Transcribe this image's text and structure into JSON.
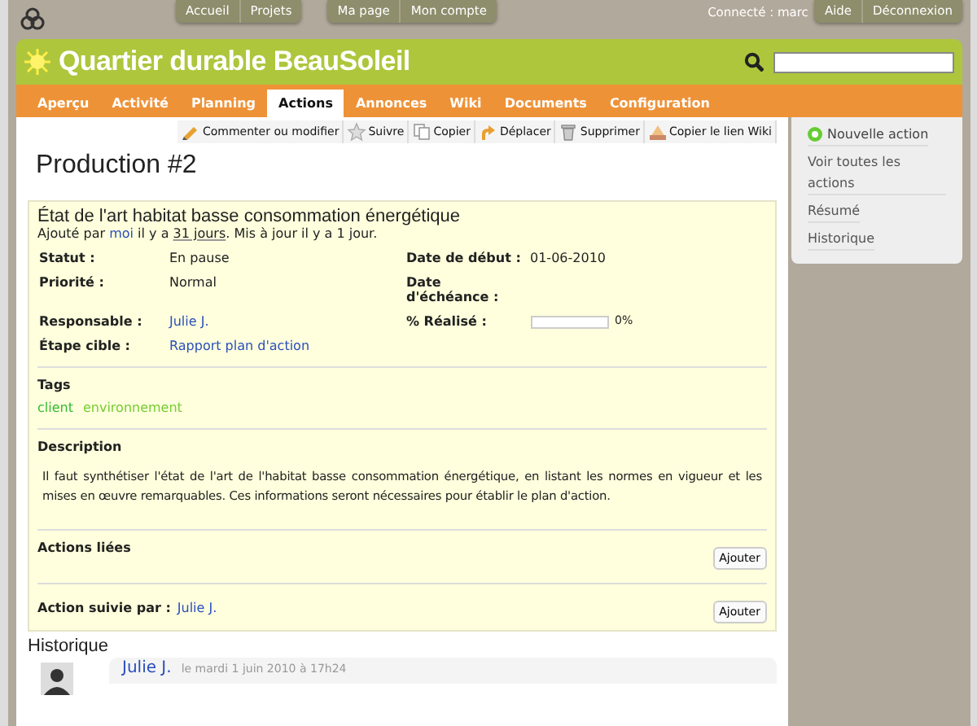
{
  "top_menu": {
    "groups": [
      [
        "Accueil",
        "Projets"
      ],
      [
        "Ma page",
        "Mon compte"
      ]
    ],
    "logged_in": "Connecté : marc",
    "account": [
      "Aide",
      "Déconnexion"
    ]
  },
  "project": {
    "title": "Quartier durable BeauSoleil"
  },
  "tabs": [
    {
      "label": "Aperçu",
      "selected": false
    },
    {
      "label": "Activité",
      "selected": false
    },
    {
      "label": "Planning",
      "selected": false
    },
    {
      "label": "Actions",
      "selected": true
    },
    {
      "label": "Annonces",
      "selected": false
    },
    {
      "label": "Wiki",
      "selected": false
    },
    {
      "label": "Documents",
      "selected": false
    },
    {
      "label": "Configuration",
      "selected": false
    }
  ],
  "contextual": [
    {
      "kind": "edit",
      "label": "Commenter ou modifier"
    },
    {
      "kind": "watch",
      "label": "Suivre"
    },
    {
      "kind": "copy",
      "label": "Copier"
    },
    {
      "kind": "move",
      "label": "Déplacer"
    },
    {
      "kind": "delete",
      "label": "Supprimer"
    },
    {
      "kind": "wiki",
      "label": "Copier le lien Wiki"
    }
  ],
  "issue": {
    "heading": "Production #2",
    "subject": "État de l'art habitat basse consommation énergétique",
    "author_line": [
      {
        "kind": "text",
        "text": "Ajouté par"
      },
      {
        "kind": "link",
        "text": "moi"
      },
      {
        "kind": "text",
        "text": "il y a"
      },
      {
        "kind": "date",
        "text": "31 jours"
      },
      {
        "kind": "text",
        "text": ". Mis à jour il y a 1 jour."
      }
    ],
    "attributes": [
      {
        "label": "Statut :",
        "kind": "text",
        "value": "En pause"
      },
      {
        "label": "Date de début :",
        "kind": "text",
        "value": "01-06-2010"
      },
      {
        "label": "Priorité :",
        "kind": "text",
        "value": "Normal"
      },
      {
        "label": "Date d'échéance :",
        "kind": "empty"
      },
      {
        "label": "Responsable :",
        "kind": "link",
        "value": "Julie J."
      },
      {
        "label": "% Réalisé :",
        "kind": "progress",
        "level": 0,
        "reading": "0%"
      },
      {
        "label": "Étape cible :",
        "kind": "link",
        "value": "Rapport plan d'action"
      }
    ],
    "tags_title": "Tags",
    "tags": [
      {
        "label": "client",
        "color": "#33bb33"
      },
      {
        "label": "environnement",
        "color": "#77cc33"
      }
    ],
    "description_title": "Description",
    "description": "Il faut synthétiser l'état de l'art de l'habitat basse consommation énergétique, en listant les normes en vigueur et les mises en œuvre remarquables. Ces informations seront nécessaires pour établir le plan d'action.",
    "relations_title": "Actions liées",
    "relations_button": "Ajouter",
    "watchers_title": "Action suivie par :",
    "watchers": [
      "Julie J."
    ],
    "watchers_button": "Ajouter"
  },
  "history": {
    "title": "Historique",
    "entries": [
      {
        "author": "Julie J.",
        "date": "le mardi 1 juin 2010 à 17h24"
      }
    ]
  },
  "sidebar": {
    "items": [
      {
        "kind": "new",
        "label": "Nouvelle action"
      },
      {
        "kind": "link",
        "label": "Voir toutes les actions"
      },
      {
        "kind": "link",
        "label": "Résumé"
      },
      {
        "kind": "link",
        "label": "Historique"
      }
    ]
  }
}
